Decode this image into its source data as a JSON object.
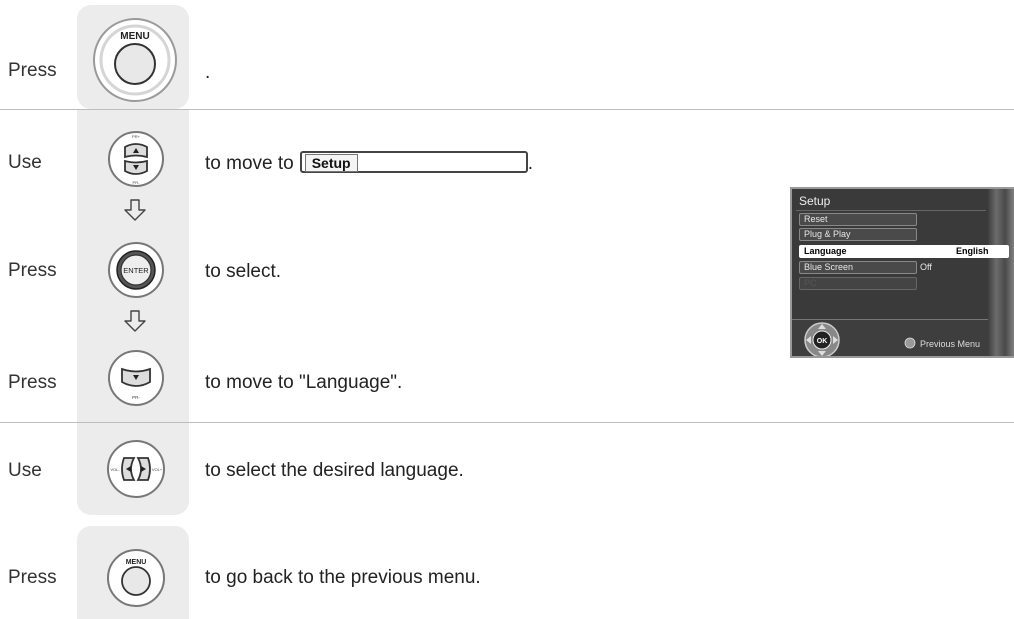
{
  "steps": {
    "press_1": "Press",
    "instr_1": ".",
    "use_1": "Use",
    "instr_2a": "to move to",
    "setup_label": "Setup",
    "instr_2b": ".",
    "press_2": "Press",
    "instr_3": "to select.",
    "press_3": "Press",
    "instr_4": "to move to \"Language\".",
    "use_2": "Use",
    "instr_5": "to select the desired language.",
    "press_4": "Press",
    "instr_6": "to go back to the previous menu."
  },
  "buttons": {
    "menu": "MENU",
    "enter": "ENTER",
    "ok": "OK",
    "pr_up": "PR+",
    "pr_down": "PR-",
    "vol_minus": "VOL-",
    "vol_plus": "VOL+"
  },
  "osd": {
    "title": "Setup",
    "items": [
      {
        "label": "Reset",
        "value": "",
        "state": "normal"
      },
      {
        "label": "Plug & Play",
        "value": "",
        "state": "normal"
      },
      {
        "label": "Language",
        "value": "English",
        "state": "selected"
      },
      {
        "label": "Blue Screen",
        "value": "Off",
        "state": "normal"
      },
      {
        "label": "PC",
        "value": "",
        "state": "dim"
      }
    ],
    "previous_menu": "Previous Menu",
    "ok_label": "OK"
  },
  "colors": {
    "panel_gray": "#ececec",
    "divider": "#bdbdbd",
    "osd_bg": "#3a3a3a",
    "osd_selected": "#ffffff"
  },
  "icons": [
    "menu-button-icon",
    "channel-up-down-icon",
    "enter-button-icon",
    "channel-down-icon",
    "volume-left-right-icon",
    "down-arrow-icon",
    "ok-navigation-icon",
    "previous-menu-dot-icon"
  ]
}
